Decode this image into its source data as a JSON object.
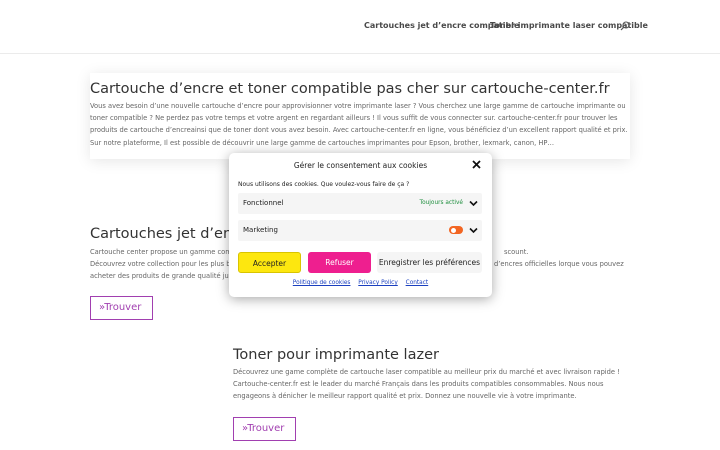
{
  "nav": {
    "items": [
      "Cartouches jet d’encre compatible",
      "Toner imprimante laser compatible"
    ],
    "search_icon": "search-icon"
  },
  "intro": {
    "title": "Cartouche d’encre et toner compatible pas cher sur cartouche-center.fr",
    "body": "Vous avez besoin d’une nouvelle cartouche d’encre pour approvisionner votre imprimante laser ? Vous cherchez une large gamme de cartouche imprimante ou toner compatible ? Ne perdez pas votre temps et votre argent en regardant ailleurs ! Il vous suffit de vous connecter sur. cartouche-center.fr pour trouver les produits de cartouche d’encreainsi que de toner dont vous avez besoin. Avec cartouche-center.fr en ligne, vous bénéficiez d’un excellent rapport qualité et prix. Sur notre plateforme, Il est possible de découvrir une large gamme de cartouches imprimantes pour Epson, brother, lexmark, canon, HP…"
  },
  "section_jet": {
    "title": "Cartouches jet d’encre",
    "line1_left": "Cartouche center propose un gamme com",
    "line1_right": "scount.",
    "line2_left": "Découvrez votre collection pour les plus be",
    "line2_right": "d’encres officielles lorque vous pouvez",
    "line3": "acheter des produits de grande qualité jus",
    "button": "»Trouver"
  },
  "section_toner": {
    "title": "Toner pour imprimante lazer",
    "body": "Découvrez une game complète de cartouche laser compatible au meilleur prix du marché et avec livraison rapide ! Cartouche-center.fr est le leader du marché Français dans les produits compatibles consommables. Nous nous engageons à dénicher  le meilleur rapport qualité et prix. Donnez une nouvelle vie à votre imprimante.",
    "button": "»Trouver"
  },
  "consent": {
    "title": "Gérer le consentement aux cookies",
    "description": "Nous utilisons des cookies. Que voulez-vous faire de ça ?",
    "rows": [
      {
        "label": "Fonctionnel",
        "status": "Toujours activé"
      },
      {
        "label": "Marketing"
      }
    ],
    "accept": "Accepter",
    "refuse": "Refuser",
    "save": "Enregistrer les préférences",
    "links": [
      "Politique de cookies",
      "Privacy Policy",
      "Contact"
    ],
    "colors": {
      "accept": "#fde70f",
      "refuse": "#ee1f8f",
      "toggle": "#f26522",
      "status": "#1e8e3e"
    }
  }
}
